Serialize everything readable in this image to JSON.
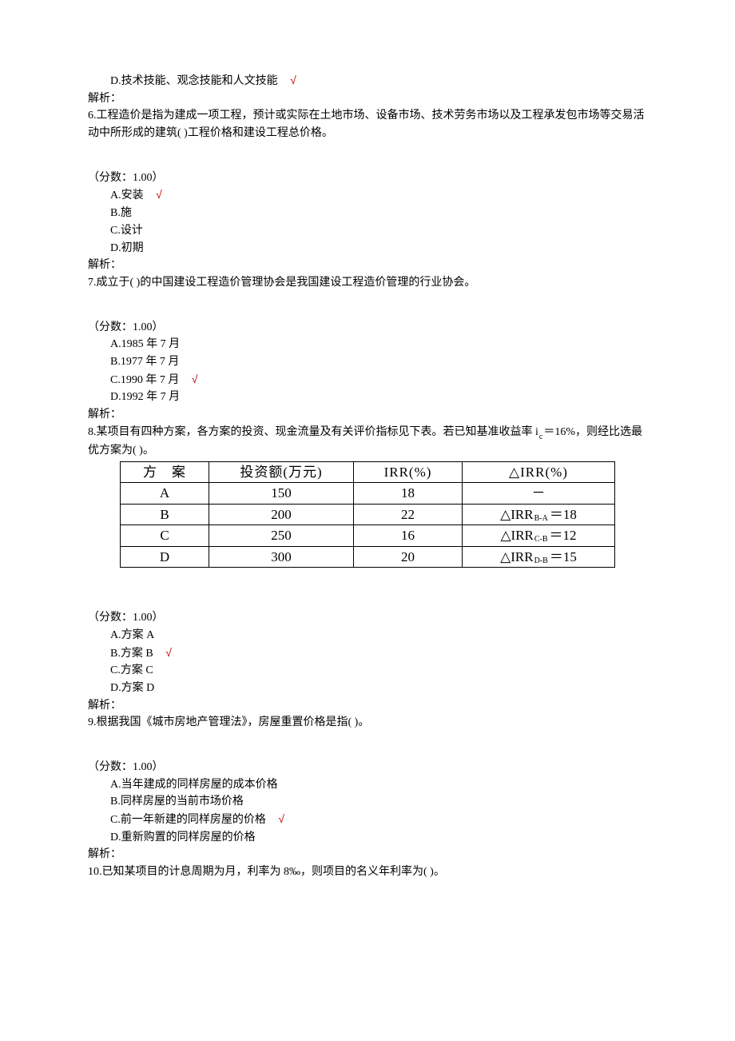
{
  "q5": {
    "optD": "D.技术技能、观念技能和人文技能",
    "analysis": "解析："
  },
  "q6": {
    "stem": "6.工程造价是指为建成一项工程，预计或实际在土地市场、设备市场、技术劳务市场以及工程承发包市场等交易活动中所形成的建筑( )工程价格和建设工程总价格。",
    "score": "（分数：1.00）",
    "optA": "A.安装",
    "optB": "B.施",
    "optC": "C.设计",
    "optD": "D.初期",
    "analysis": "解析："
  },
  "q7": {
    "stem": "7.成立于( )的中国建设工程造价管理协会是我国建设工程造价管理的行业协会。",
    "score": "（分数：1.00）",
    "optA": "A.1985 年 7 月",
    "optB": "B.1977 年 7 月",
    "optC": "C.1990 年 7 月",
    "optD": "D.1992 年 7 月",
    "analysis": "解析："
  },
  "q8": {
    "stem_a": "8.某项目有四种方案，各方案的投资、现金流量及有关评价指标见下表。若已知基准收益率 i",
    "stem_sub": "c",
    "stem_b": "＝16%，则经比选最优方案为( )。",
    "score": "（分数：1.00）",
    "optA": "A.方案 A",
    "optB": "B.方案 B",
    "optC": "C.方案 C",
    "optD": "D.方案 D",
    "analysis": "解析：",
    "table": {
      "h1": "方　案",
      "h2": "投资额(万元)",
      "h3": "IRR(%)",
      "h4_sym": "△",
      "h4_txt": "IRR(%)",
      "rows": [
        {
          "scheme": "A",
          "invest": "150",
          "irr": "18",
          "dirr_sym": "",
          "dirr_sub": "",
          "dirr_val": "－"
        },
        {
          "scheme": "B",
          "invest": "200",
          "irr": "22",
          "dirr_sym": "△IRR",
          "dirr_sub": "B-A",
          "dirr_val": "＝18"
        },
        {
          "scheme": "C",
          "invest": "250",
          "irr": "16",
          "dirr_sym": "△IRR",
          "dirr_sub": "C-B",
          "dirr_val": "＝12"
        },
        {
          "scheme": "D",
          "invest": "300",
          "irr": "20",
          "dirr_sym": "△IRR",
          "dirr_sub": "D-B",
          "dirr_val": "＝15"
        }
      ]
    }
  },
  "q9": {
    "stem": "9.根据我国《城市房地产管理法》，房屋重置价格是指( )。",
    "score": "（分数：1.00）",
    "optA": "A.当年建成的同样房屋的成本价格",
    "optB": "B.同样房屋的当前市场价格",
    "optC": "C.前一年新建的同样房屋的价格",
    "optD": "D.重新购置的同样房屋的价格",
    "analysis": "解析："
  },
  "q10": {
    "stem": "10.已知某项目的计息周期为月，利率为 8‰，则项目的名义年利率为( )。"
  },
  "checkmark": "√"
}
